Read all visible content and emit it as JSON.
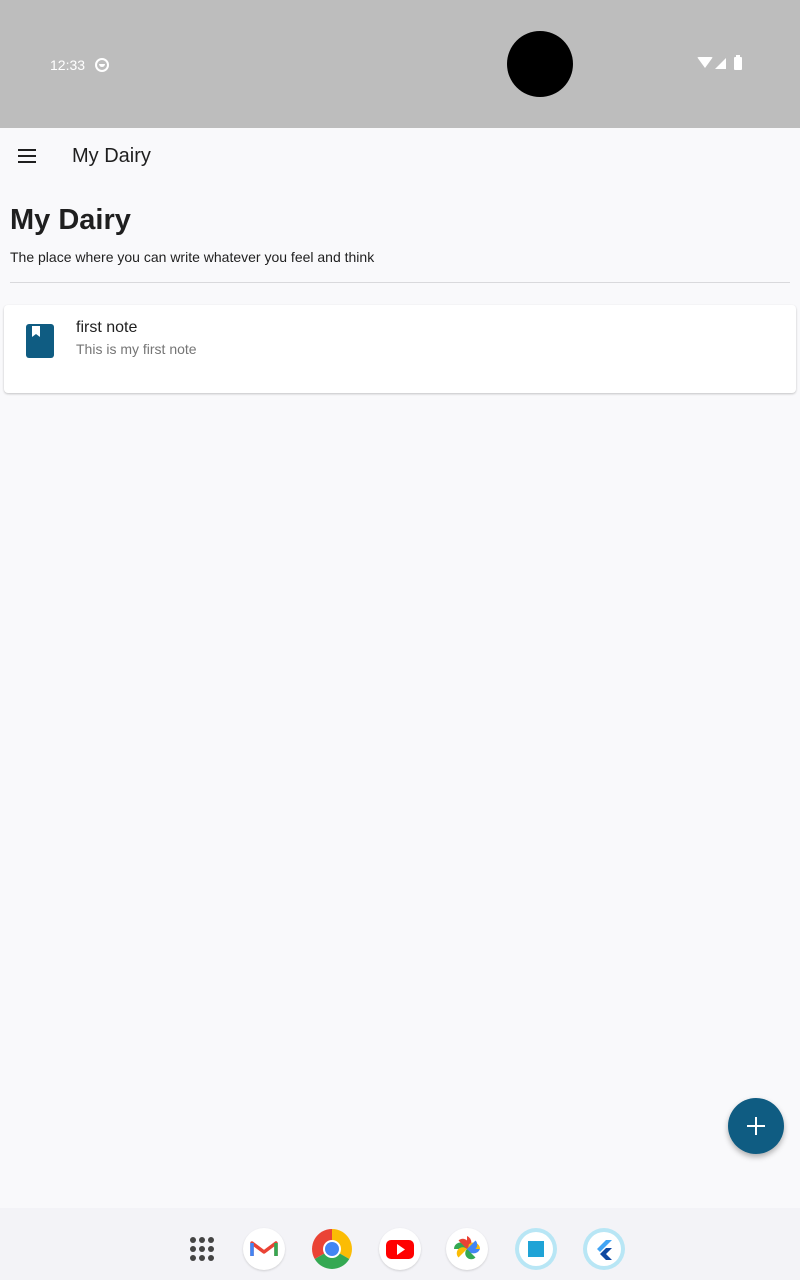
{
  "status_bar": {
    "time": "12:33"
  },
  "app_bar": {
    "title": "My Dairy"
  },
  "page": {
    "heading": "My Dairy",
    "subtitle": "The place where you can write whatever you feel and think"
  },
  "notes": [
    {
      "title": "first note",
      "description": "This is my first note"
    }
  ],
  "colors": {
    "primary": "#0f5c82",
    "status_bar": "#bdbdbd",
    "background": "#f9f9fb"
  },
  "icons": {
    "menu": "menu-icon",
    "note": "book-icon",
    "fab": "plus-icon"
  },
  "dock": [
    "app-drawer",
    "gmail",
    "chrome",
    "youtube",
    "photos",
    "square-app",
    "flutter"
  ]
}
